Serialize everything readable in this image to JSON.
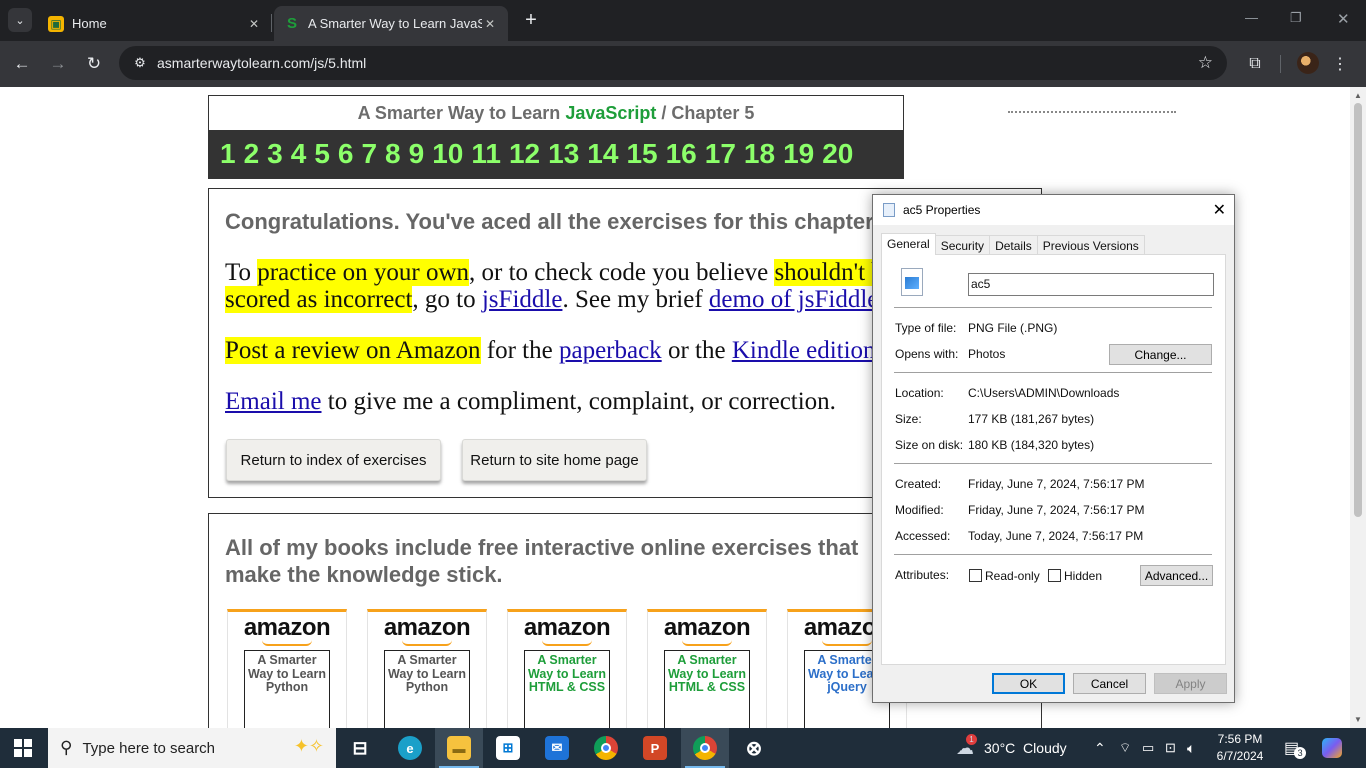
{
  "browser": {
    "tabs": [
      {
        "title": "Home",
        "active": false
      },
      {
        "title": "A Smarter Way to Learn JavaScript",
        "active": true
      }
    ],
    "url": "asmarterwaytolearn.com/js/5.html"
  },
  "page": {
    "header": {
      "prefix": "A Smarter Way to Learn ",
      "js": "JavaScript",
      "suffix": " / Chapter 5"
    },
    "chapters": [
      "1",
      "2",
      "3",
      "4",
      "5",
      "6",
      "7",
      "8",
      "9",
      "10",
      "11",
      "12",
      "13",
      "14",
      "15",
      "16",
      "17",
      "18",
      "19",
      "20"
    ],
    "congrats": {
      "title": "Congratulations. You've aced all the exercises for this chapter.",
      "p1": {
        "pre": "To ",
        "hl1": "practice on your own",
        "mid1": ", or to check code you believe ",
        "hl2": "shouldn't be",
        "hl3": "scored as incorrect",
        "mid2": ", go to ",
        "link1": "jsFiddle",
        "mid3": ". See my brief ",
        "link2": "demo of jsFiddle"
      },
      "p2": {
        "hl": "Post a review on Amazon",
        "mid1": " for the ",
        "link1": "paperback",
        "mid2": " or the ",
        "link2": "Kindle edition"
      },
      "p3": {
        "link": "Email me",
        "rest": " to give me a compliment, complaint, or correction."
      },
      "btn_index": "Return to index of exercises",
      "btn_home": "Return to site home page"
    },
    "books": {
      "title": "All of my books include free interactive online exercises that make the knowledge stick.",
      "items": [
        {
          "brand": "amazon",
          "cover": "A Smarter Way to Learn Python",
          "color": "#555555"
        },
        {
          "brand": "amazon",
          "cover": "A Smarter Way to Learn Python",
          "color": "#555555"
        },
        {
          "brand": "amazon",
          "cover": "A Smarter Way to Learn HTML & CSS",
          "color": "#1e9e3a"
        },
        {
          "brand": "amazon",
          "cover": "A Smarter Way to Learn HTML & CSS",
          "color": "#1e9e3a"
        },
        {
          "brand": "amazon",
          "cover": "A Smarter Way to Learn jQuery",
          "color": "#2c6fc9"
        }
      ]
    }
  },
  "dialog": {
    "title": "ac5 Properties",
    "tabs": [
      "General",
      "Security",
      "Details",
      "Previous Versions"
    ],
    "filename": "ac5",
    "rows": {
      "type_label": "Type of file:",
      "type_value": "PNG File (.PNG)",
      "opens_label": "Opens with:",
      "opens_value": "Photos",
      "change_btn": "Change...",
      "location_label": "Location:",
      "location_value": "C:\\Users\\ADMIN\\Downloads",
      "size_label": "Size:",
      "size_value": "177 KB (181,267 bytes)",
      "disk_label": "Size on disk:",
      "disk_value": "180 KB (184,320 bytes)",
      "created_label": "Created:",
      "created_value": "Friday, June 7, 2024, 7:56:17 PM",
      "modified_label": "Modified:",
      "modified_value": "Friday, June 7, 2024, 7:56:17 PM",
      "accessed_label": "Accessed:",
      "accessed_value": "Today, June 7, 2024, 7:56:17 PM",
      "attr_label": "Attributes:",
      "readonly": "Read-only",
      "hidden": "Hidden",
      "advanced_btn": "Advanced..."
    },
    "buttons": {
      "ok": "OK",
      "cancel": "Cancel",
      "apply": "Apply"
    }
  },
  "taskbar": {
    "search_placeholder": "Type here to search",
    "weather": "30°C  Cloudy",
    "time": "7:56 PM",
    "date": "6/7/2024",
    "notifications": "3",
    "weather_badge": "1"
  },
  "colors": {
    "chapter_green": "#8cff6a",
    "js_green": "#1e9e3a",
    "highlight": "#ffff00",
    "link": "#1a0dab"
  }
}
